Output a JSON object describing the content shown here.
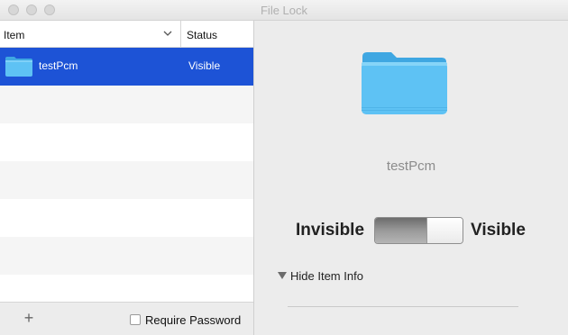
{
  "window": {
    "title": "File Lock"
  },
  "table": {
    "columns": {
      "item": "Item",
      "status": "Status"
    },
    "rows": [
      {
        "name": "testPcm",
        "status": "Visible",
        "selected": true
      }
    ]
  },
  "footer": {
    "add_label": "+",
    "require_password_label": "Require Password"
  },
  "detail": {
    "item_name": "testPcm",
    "invisible_label": "Invisible",
    "visible_label": "Visible",
    "toggle_state": "visible",
    "disclosure_label": "Hide Item Info"
  },
  "colors": {
    "selection": "#1d53d6",
    "folder": "#5ec2f4"
  },
  "icons": {
    "folder": "folder-icon",
    "sort": "chevron-down-icon",
    "disclosure": "disclosure-triangle-icon"
  }
}
